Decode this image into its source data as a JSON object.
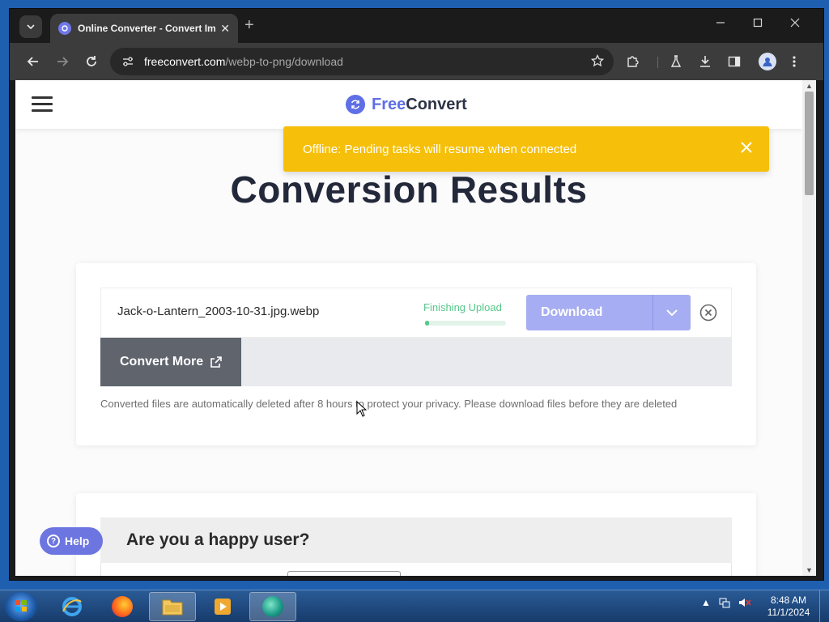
{
  "browser": {
    "tab_title": "Online Converter - Convert Im",
    "tab_close": "✕",
    "new_tab": "+",
    "url_host": "freeconvert.com",
    "url_path": "/webp-to-png/download"
  },
  "site": {
    "logo_free": "Free",
    "logo_convert": "Convert"
  },
  "banner": {
    "text": "Offline: Pending tasks will resume when connected"
  },
  "page": {
    "title": "Conversion Results"
  },
  "results": {
    "file_name": "Jack-o-Lantern_2003-10-31.jpg.webp",
    "status": "Finishing Upload",
    "progress_fraction": 0.05,
    "download_label": "Download",
    "convert_more_label": "Convert More",
    "privacy_note": "Converted files are automatically deleted after 8 hours to protect your privacy. Please download files before they are deleted"
  },
  "feedback": {
    "title": "Are you a happy user?"
  },
  "help": {
    "label": "Help",
    "icon": "?"
  },
  "taskbar": {
    "time": "8:48 AM",
    "date": "11/1/2024"
  },
  "colors": {
    "banner": "#f6bf0a",
    "brand": "#5f6fe6",
    "download_disabled": "#a6adf2",
    "status_green": "#57c78a"
  }
}
